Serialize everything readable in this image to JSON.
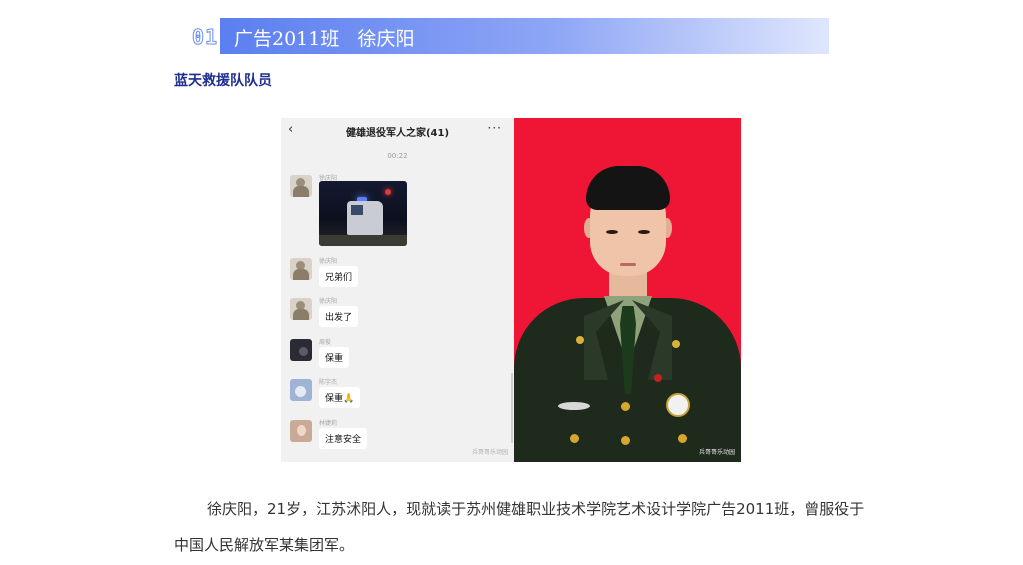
{
  "header": {
    "number": "01",
    "title": "广告2011班   徐庆阳",
    "gradient_colors": [
      "#5b7ff0",
      "#dfe6fd"
    ]
  },
  "subtitle": "蓝天救援队队员",
  "chat": {
    "back_icon": "chevron-left",
    "title": "健雄退役军人之家(41)",
    "more_icon": "ellipsis",
    "time": "00:22",
    "messages": [
      {
        "nick": "徐庆阳",
        "type": "video",
        "text": ""
      },
      {
        "nick": "徐庆阳",
        "type": "text",
        "text": "兄弟们"
      },
      {
        "nick": "徐庆阳",
        "type": "text",
        "text": "出发了"
      },
      {
        "nick": "周俊",
        "type": "text",
        "text": "保重"
      },
      {
        "nick": "陈宇杰",
        "type": "text",
        "text": "保重🙏"
      },
      {
        "nick": "林婕莉",
        "type": "text",
        "text": "注意安全"
      }
    ],
    "watermark": "兵哥哥乐动园"
  },
  "portrait": {
    "background_color": "#ee1535",
    "watermark": "兵哥哥乐动园"
  },
  "paragraph": "徐庆阳，21岁，江苏沭阳人，现就读于苏州健雄职业技术学院艺术设计学院广告2011班，曾服役于中国人民解放军某集团军。"
}
